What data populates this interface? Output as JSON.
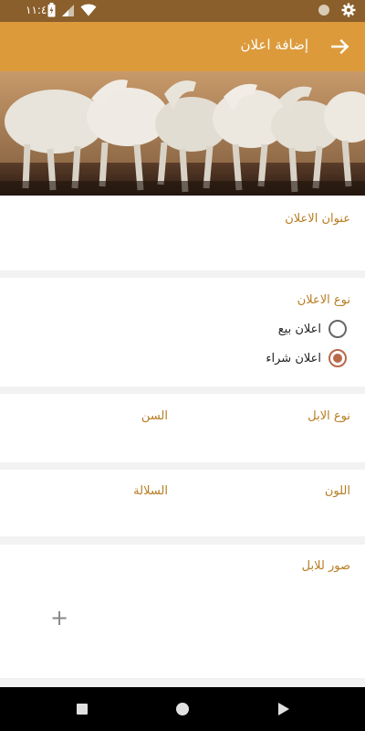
{
  "status_bar": {
    "time": "١١:٤٠",
    "icons": [
      "battery-charging-icon",
      "signal-icon",
      "wifi-icon",
      "circle-indicator-icon",
      "gear-icon"
    ]
  },
  "app_bar": {
    "title": "إضافة اعلان",
    "back_icon": "arrow-right-icon",
    "color": "#dc9a3b"
  },
  "hero": {
    "icon": "camels-photo"
  },
  "form": {
    "ad_title_label": "عنوان الاعلان",
    "ad_type_label": "نوع الاعلان",
    "ad_types": [
      {
        "label": "اعلان بيع",
        "selected": false
      },
      {
        "label": "اعلان شراء",
        "selected": true
      }
    ],
    "camel_type_label": "نوع الابل",
    "age_label": "السن",
    "color_label": "اللون",
    "breed_label": "السلالة",
    "photos_label": "صور للابل",
    "add_photo_label": "+"
  },
  "nav_bar": {
    "icons": [
      "recent-apps-icon",
      "home-icon",
      "back-icon"
    ]
  },
  "colors": {
    "accent": "#b77d22",
    "radio_selected": "#b8694a"
  }
}
